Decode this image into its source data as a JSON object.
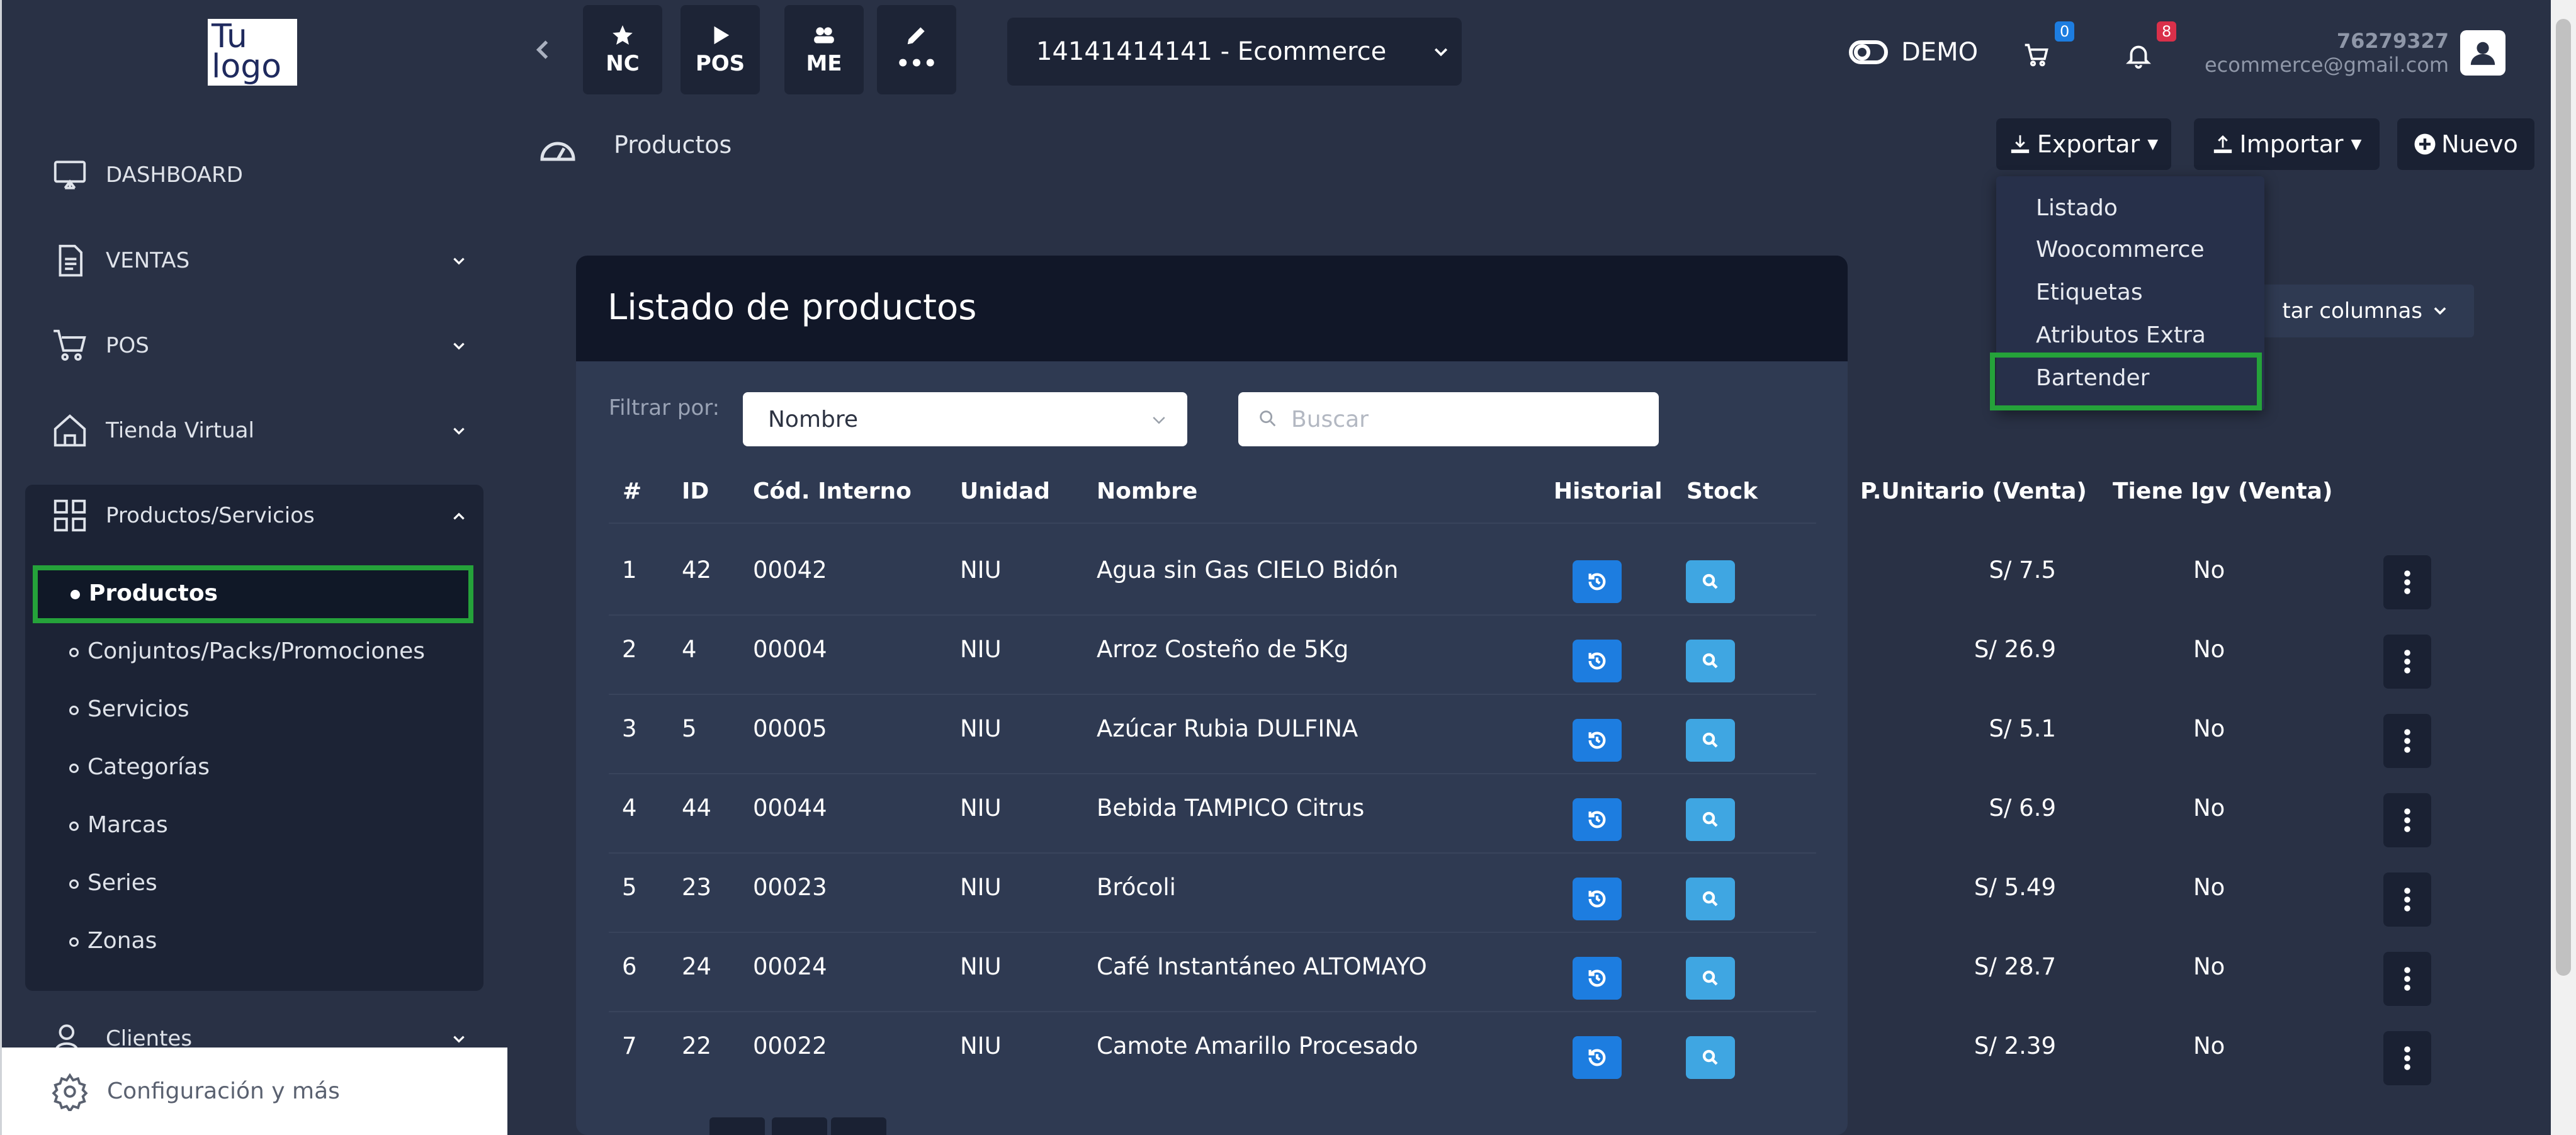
{
  "app": {
    "logo_line1": "Tu",
    "logo_line2": "logo"
  },
  "sidebar": {
    "items": [
      {
        "label": "DASHBOARD",
        "icon": "monitor-icon"
      },
      {
        "label": "VENTAS",
        "icon": "document-icon"
      },
      {
        "label": "POS",
        "icon": "cart-icon"
      },
      {
        "label": "Tienda Virtual",
        "icon": "home-icon"
      },
      {
        "label": "Productos/Servicios",
        "icon": "grid-icon"
      },
      {
        "label": "Clientes",
        "icon": "user-icon"
      }
    ],
    "submenu": [
      {
        "label": "Productos",
        "active": true
      },
      {
        "label": "Conjuntos/Packs/Promociones"
      },
      {
        "label": "Servicios"
      },
      {
        "label": "Categorías"
      },
      {
        "label": "Marcas"
      },
      {
        "label": "Series"
      },
      {
        "label": "Zonas"
      }
    ],
    "config_label": "Configuración y más"
  },
  "topbar": {
    "quick_buttons": [
      {
        "label": "NC",
        "icon": "star-icon"
      },
      {
        "label": "POS",
        "icon": "play-icon"
      },
      {
        "label": "ME",
        "icon": "people-icon"
      },
      {
        "label": "•••",
        "icon": "pencil-icon"
      }
    ],
    "company": "14141414141 - Ecommerce",
    "demo_label": "DEMO",
    "cart_count": "0",
    "notif_count": "8",
    "user_id": "76279327",
    "user_email": "ecommerce@gmail.com"
  },
  "page": {
    "breadcrumb": "Productos",
    "export_label": "Exportar",
    "import_label": "Importar",
    "new_label": "Nuevo"
  },
  "export_menu": {
    "items": [
      "Listado",
      "Woocommerce",
      "Etiquetas",
      "Atributos Extra",
      "Bartender"
    ]
  },
  "card": {
    "title": "Listado de productos",
    "columns_btn": "tar columnas",
    "filter_label": "Filtrar por:",
    "filter_value": "Nombre",
    "search_placeholder": "Buscar"
  },
  "table": {
    "headers": [
      "#",
      "ID",
      "Cód. Interno",
      "Unidad",
      "Nombre",
      "Historial",
      "Stock",
      "P.Unitario (Venta)",
      "Tiene Igv (Venta)"
    ],
    "rows": [
      {
        "n": "1",
        "id": "42",
        "code": "00042",
        "unit": "NIU",
        "name": "Agua sin Gas CIELO Bidón",
        "price": "S/ 7.5",
        "igv": "No"
      },
      {
        "n": "2",
        "id": "4",
        "code": "00004",
        "unit": "NIU",
        "name": "Arroz Costeño de 5Kg",
        "price": "S/ 26.9",
        "igv": "No"
      },
      {
        "n": "3",
        "id": "5",
        "code": "00005",
        "unit": "NIU",
        "name": "Azúcar Rubia DULFINA",
        "price": "S/ 5.1",
        "igv": "No"
      },
      {
        "n": "4",
        "id": "44",
        "code": "00044",
        "unit": "NIU",
        "name": "Bebida TAMPICO Citrus",
        "price": "S/ 6.9",
        "igv": "No"
      },
      {
        "n": "5",
        "id": "23",
        "code": "00023",
        "unit": "NIU",
        "name": "Brócoli",
        "price": "S/ 5.49",
        "igv": "No"
      },
      {
        "n": "6",
        "id": "24",
        "code": "00024",
        "unit": "NIU",
        "name": "Café Instantáneo ALTOMAYO",
        "price": "S/ 28.7",
        "igv": "No"
      },
      {
        "n": "7",
        "id": "22",
        "code": "00022",
        "unit": "NIU",
        "name": "Camote Amarillo Procesado",
        "price": "S/ 2.39",
        "igv": "No"
      }
    ]
  },
  "colors": {
    "bg": "#293145",
    "card": "#2f3a52",
    "highlight": "#25a23a",
    "history_btn": "#1d7de0",
    "stock_btn": "#3fa6e2"
  }
}
